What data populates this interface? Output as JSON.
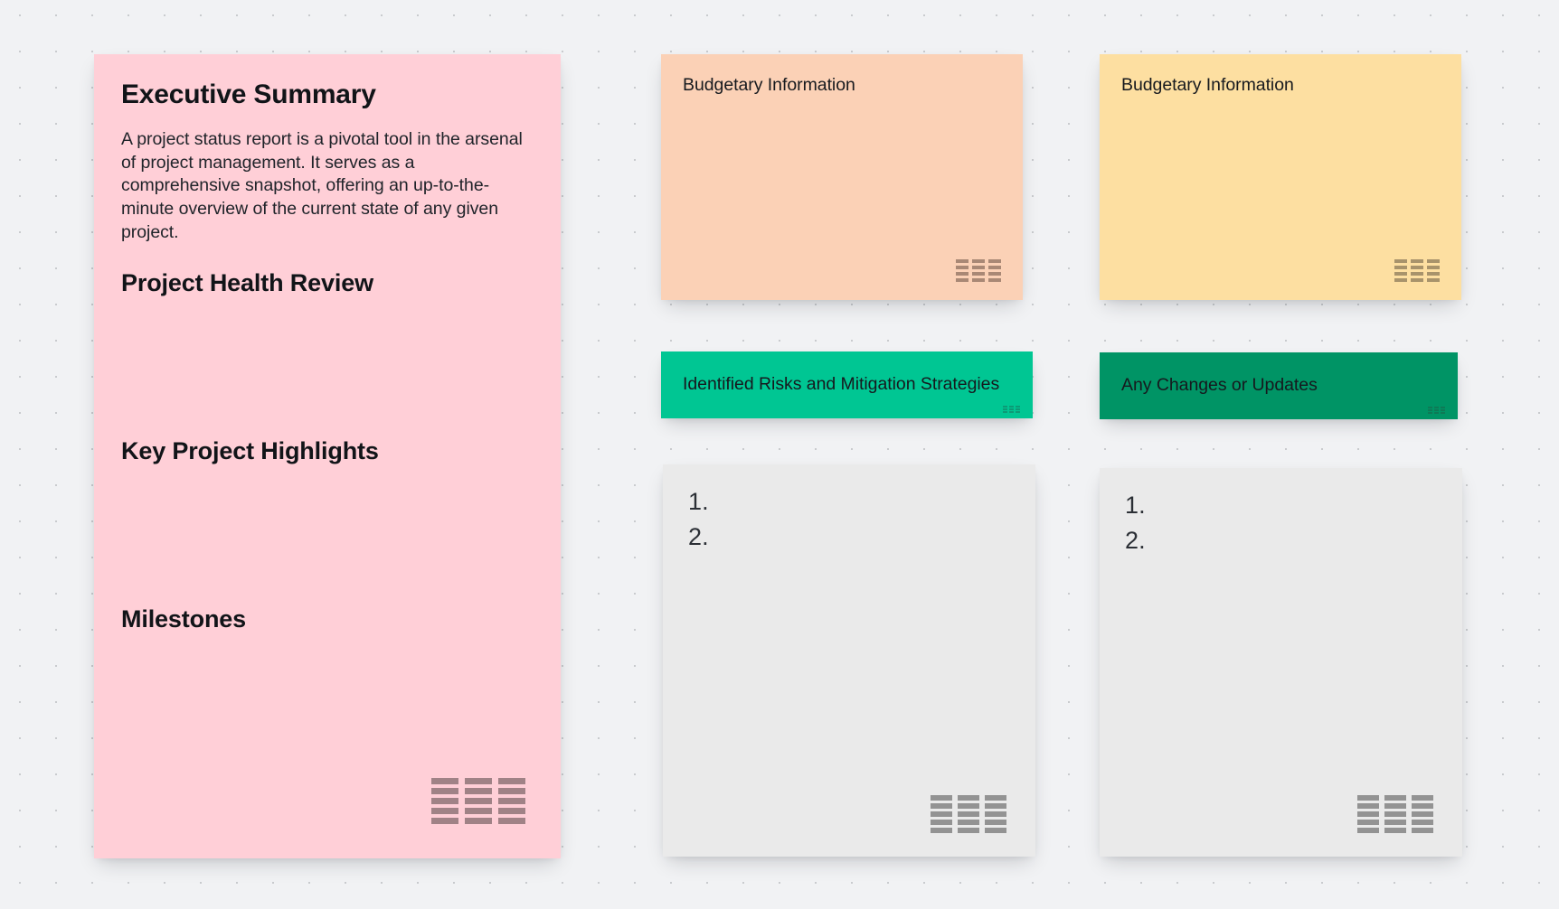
{
  "board": {
    "background_color": "#f1f2f4",
    "dot_color": "#c9cbce"
  },
  "cards": {
    "executive_summary": {
      "color": "#ffcfd7",
      "heading": "Executive Summary",
      "paragraph": "A project status report is a pivotal tool in the arsenal of project management. It serves as a comprehensive snapshot, offering an up-to-the-minute overview of the current state of any given project.",
      "section_1": "Project Health Review",
      "section_2": "Key Project Highlights",
      "section_3": "Milestones",
      "handle_icon": "resize-grip-icon"
    },
    "budgetary_a": {
      "color": "#fbd1b6",
      "title": "Budgetary Information",
      "handle_icon": "resize-grip-icon"
    },
    "budgetary_b": {
      "color": "#fddfa1",
      "title": "Budgetary Information",
      "handle_icon": "resize-grip-icon"
    },
    "risks": {
      "color": "#00c693",
      "title": "Identified Risks and Mitigation Strategies",
      "handle_icon": "resize-grip-icon"
    },
    "changes": {
      "color": "#009465",
      "title": "Any Changes or Updates",
      "handle_icon": "resize-grip-icon"
    },
    "list_a": {
      "color": "#eaeaea",
      "items": [
        "1.",
        "2."
      ],
      "handle_icon": "resize-grip-icon"
    },
    "list_b": {
      "color": "#eaeaea",
      "items": [
        "1.",
        "2."
      ],
      "handle_icon": "resize-grip-icon"
    }
  }
}
